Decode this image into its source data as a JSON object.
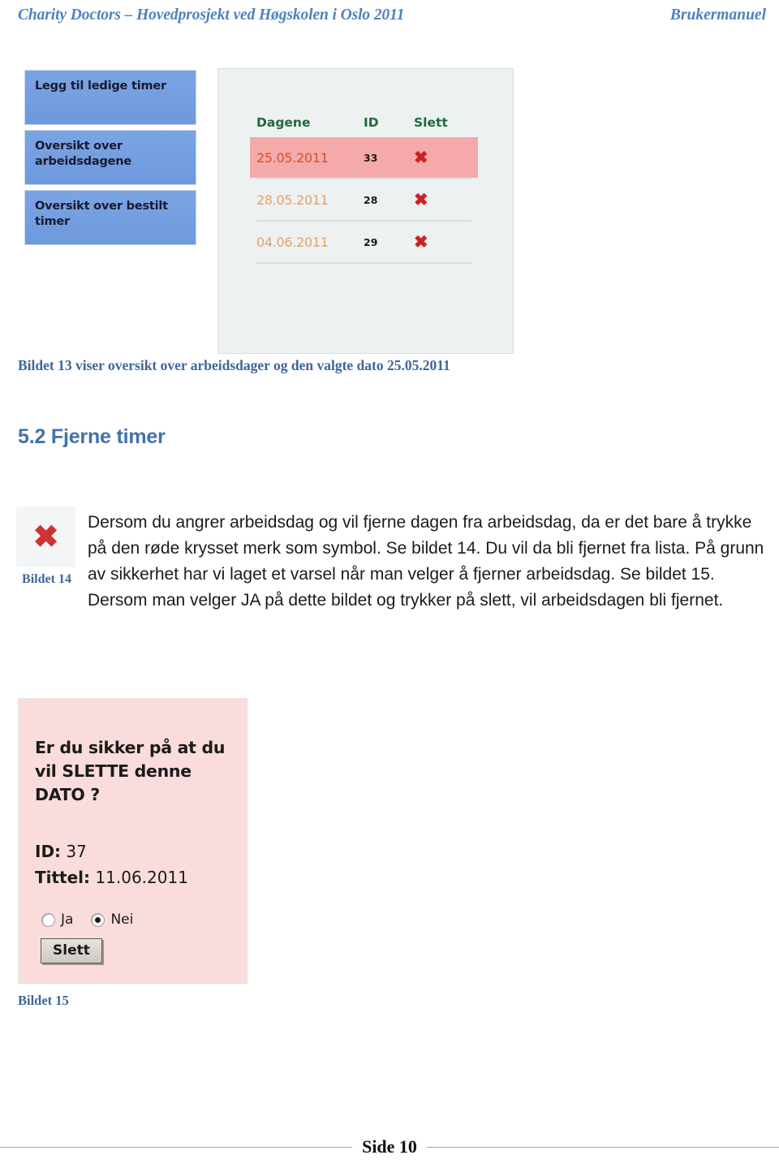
{
  "header": {
    "left": "Charity Doctors – Hovedprosjekt ved Høgskolen i Oslo 2011",
    "right": "Brukermanuel"
  },
  "figure13": {
    "nav_buttons": [
      {
        "label": "Legg til ledige timer"
      },
      {
        "label": "Oversikt over arbeidsdagene"
      },
      {
        "label": "Oversikt over bestilt timer"
      }
    ],
    "table": {
      "columns": [
        "Dagene",
        "ID",
        "Slett"
      ],
      "delete_icon": "✖",
      "rows": [
        {
          "date": "25.05.2011",
          "id": "33",
          "highlighted": true
        },
        {
          "date": "28.05.2011",
          "id": "28",
          "highlighted": false
        },
        {
          "date": "04.06.2011",
          "id": "29",
          "highlighted": false
        }
      ]
    },
    "caption": "Bildet 13 viser oversikt over arbeidsdager og den valgte dato 25.05.2011"
  },
  "section": {
    "heading": "5.2 Fjerne timer",
    "paragraph": "Dersom du angrer arbeidsdag og vil fjerne dagen fra arbeidsdag, da er det bare å trykke på den røde krysset merk som symbol. Se bildet 14. Du vil da bli fjernet fra lista. På grunn av sikkerhet har vi laget et varsel når man velger å fjerner arbeidsdag. Se bildet 15. Dersom man velger JA på dette bildet og trykker på slett, vil arbeidsdagen bli fjernet."
  },
  "figure14": {
    "icon": "✖",
    "caption": "Bildet 14"
  },
  "figure15": {
    "question": "Er du sikker på at du vil SLETTE denne DATO ?",
    "id_label": "ID:",
    "id_value": "37",
    "tittel_label": "Tittel:",
    "tittel_value": "11.06.2011",
    "radios": [
      {
        "label": "Ja",
        "selected": false
      },
      {
        "label": "Nei",
        "selected": true
      }
    ],
    "delete_button": "Slett",
    "caption": "Bildet 15"
  },
  "footer": {
    "page": "Side 10"
  },
  "colors": {
    "header_blue": "#4f81bd",
    "heading_blue": "#4372a8",
    "caption_blue": "#3f6699",
    "nav_button_blue": "#6f9ade",
    "table_header_green": "#1f6b3b",
    "row_highlight_pink": "#f4aaaa",
    "date_orange": "#e0a36a",
    "delete_red": "#cc2222",
    "dialog_pink": "#fbdcdc",
    "footer_rule": "#8fa8c0"
  }
}
